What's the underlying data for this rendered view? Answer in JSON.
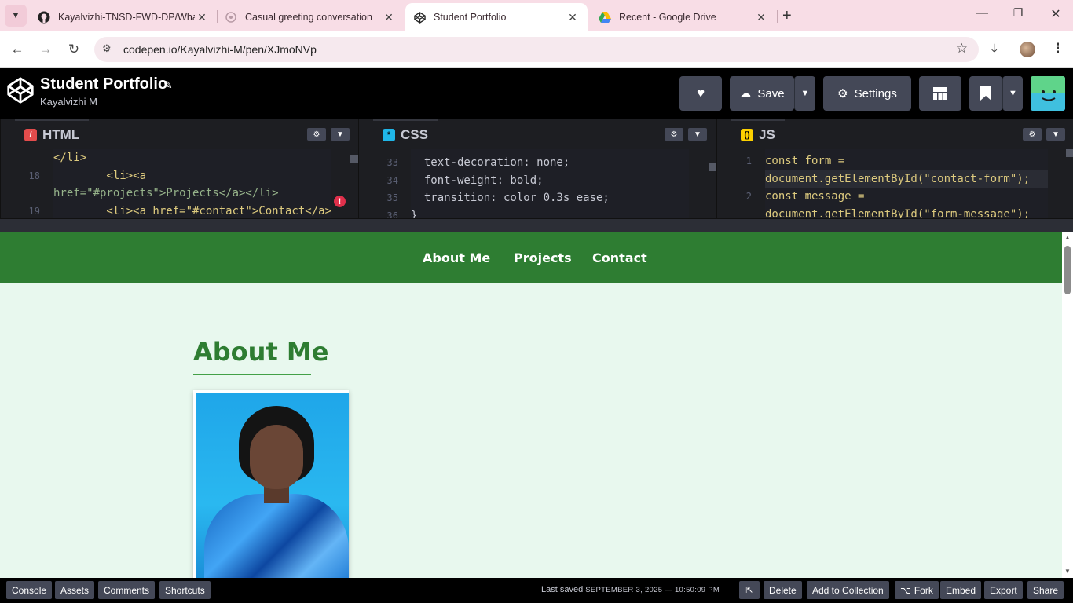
{
  "browser": {
    "tabs": [
      {
        "title": "Kayalvizhi-TNSD-FWD-DP/Wha",
        "icon": "github-icon"
      },
      {
        "title": "Casual greeting conversation",
        "icon": "chat-icon"
      },
      {
        "title": "Student Portfolio",
        "icon": "codepen-icon",
        "active": true
      },
      {
        "title": "Recent - Google Drive",
        "icon": "google-drive-icon"
      }
    ],
    "url": "codepen.io/Kayalvizhi-M/pen/XJmoNVp"
  },
  "codepen": {
    "title": "Student Portfolio",
    "author": "Kayalvizhi M",
    "buttons": {
      "save": "Save",
      "settings": "Settings"
    },
    "panes": {
      "html": {
        "label": "HTML",
        "line_numbers": [
          "",
          "18",
          "",
          "19"
        ],
        "lines": [
          "</li>",
          "        <li><a",
          "href=\"#projects\">Projects</a></li>",
          "        <li><a href=\"#contact\">Contact</a>"
        ]
      },
      "css": {
        "label": "CSS",
        "line_numbers": [
          "33",
          "34",
          "35",
          "36"
        ],
        "lines": [
          "  text-decoration: none;",
          "  font-weight: bold;",
          "  transition: color 0.3s ease;",
          "}"
        ]
      },
      "js": {
        "label": "JS",
        "line_numbers": [
          "1",
          "",
          "2",
          ""
        ],
        "lines": [
          "const form =",
          "document.getElementById(\"contact-form\");",
          "const message =",
          "document.getElementById(\"form-message\");"
        ]
      }
    },
    "footer": {
      "console": "Console",
      "assets": "Assets",
      "comments": "Comments",
      "shortcuts": "Shortcuts",
      "last_saved_label": "Last saved",
      "last_saved_time": "SEPTEMBER 3, 2025 — 10:50:09 PM",
      "delete": "Delete",
      "add_to_collection": "Add to Collection",
      "fork": "Fork",
      "embed": "Embed",
      "export": "Export",
      "share": "Share"
    }
  },
  "preview": {
    "nav": [
      "About Me",
      "Projects",
      "Contact"
    ],
    "heading": "About Me",
    "colors": {
      "nav_bg": "#2e7d32",
      "page_bg": "#e8f8ee",
      "heading": "#2e7d32"
    }
  }
}
